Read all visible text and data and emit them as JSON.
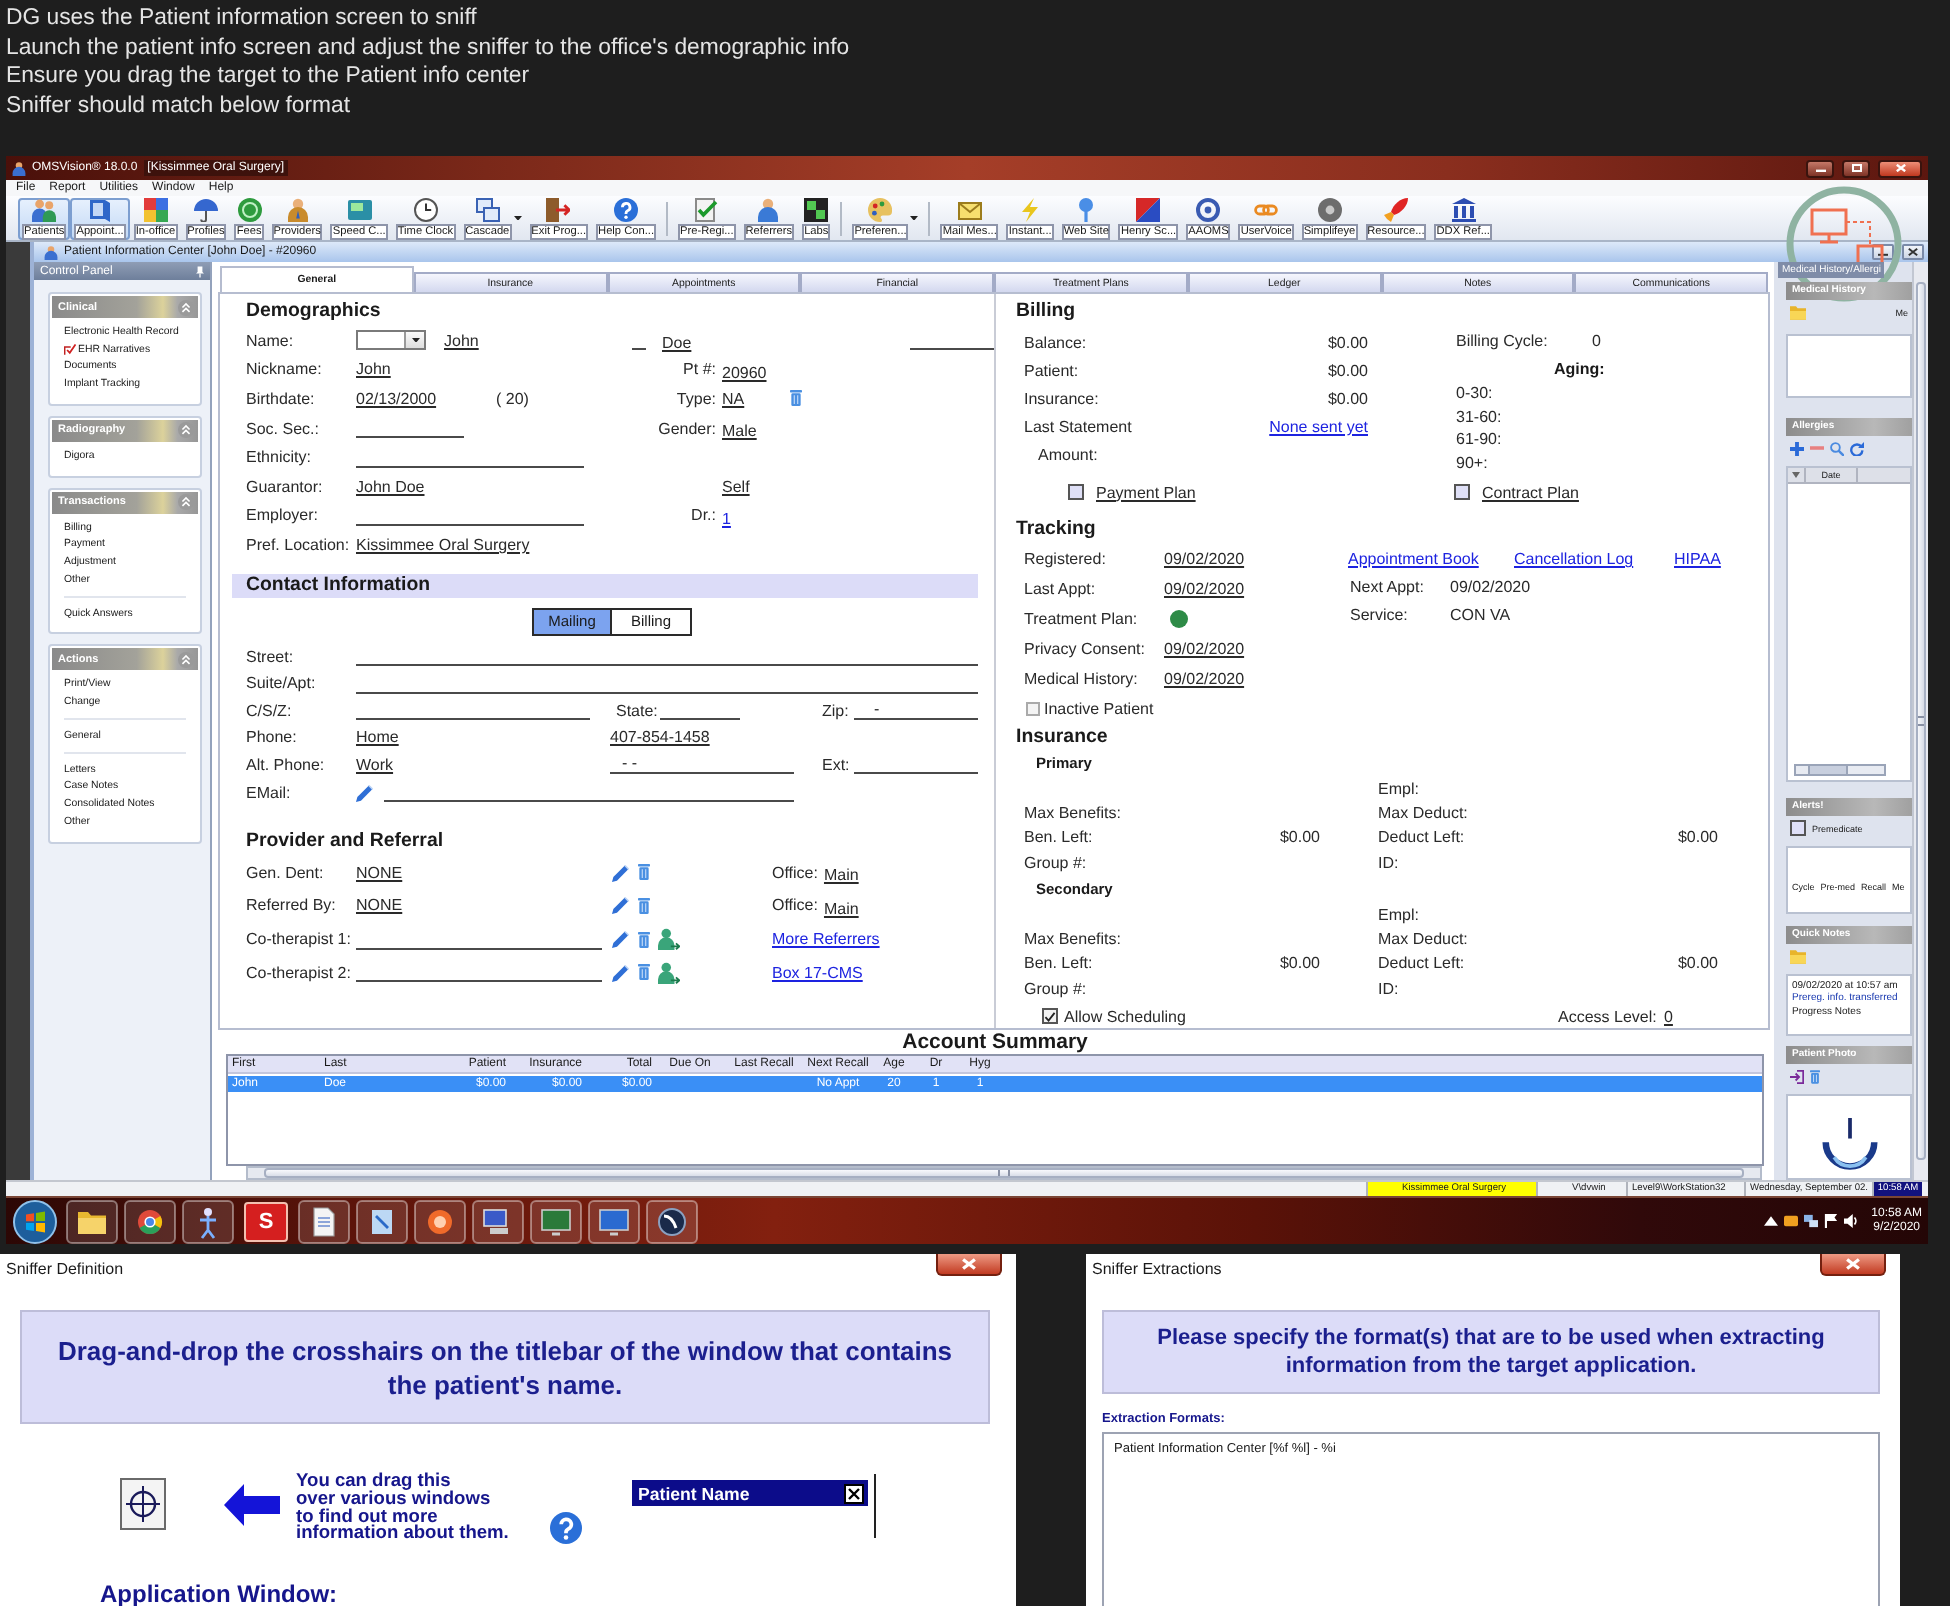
{
  "instructions": [
    "DG uses the Patient information screen to sniff",
    "Launch the patient info screen and adjust the sniffer to the office's demographic info",
    "Ensure you drag the target to the Patient info center",
    "Sniffer should match below format"
  ],
  "app_window": {
    "title": "OMSVision® 18.0.0",
    "title_context": "[Kissimmee Oral Surgery]"
  },
  "menu": [
    "File",
    "Report",
    "Utilities",
    "Window",
    "Help"
  ],
  "toolbar": [
    {
      "items": [
        {
          "label": "Patients",
          "selected": true,
          "dropdown": false
        },
        {
          "label": "Appoint...",
          "selected": true,
          "dropdown": false
        },
        {
          "label": "In-office",
          "selected": false,
          "dropdown": false
        },
        {
          "label": "Profiles",
          "selected": false,
          "dropdown": false
        },
        {
          "label": "Fees",
          "selected": false,
          "dropdown": false
        },
        {
          "label": "Providers",
          "selected": false,
          "dropdown": false
        },
        {
          "label": "Speed C...",
          "selected": false,
          "dropdown": false
        },
        {
          "label": "Time Clock",
          "selected": false,
          "dropdown": false
        },
        {
          "label": "Cascade",
          "selected": false,
          "dropdown": true
        },
        {
          "label": "Exit Prog...",
          "selected": false,
          "dropdown": false
        },
        {
          "label": "Help Con...",
          "selected": false,
          "dropdown": false
        }
      ]
    },
    {
      "items": [
        {
          "label": "Pre-Regi...",
          "selected": false,
          "dropdown": false
        },
        {
          "label": "Referrers",
          "selected": false,
          "dropdown": false
        },
        {
          "label": "Labs",
          "selected": false,
          "dropdown": false
        }
      ]
    },
    {
      "items": [
        {
          "label": "Preferen...",
          "selected": false,
          "dropdown": true
        }
      ]
    },
    {
      "items": [
        {
          "label": "Mail Mes...",
          "selected": false,
          "dropdown": false
        },
        {
          "label": "Instant...",
          "selected": false,
          "dropdown": false
        },
        {
          "label": "Web Site",
          "selected": false,
          "dropdown": false
        },
        {
          "label": "Henry Sc...",
          "selected": false,
          "dropdown": false
        },
        {
          "label": "AAOMS",
          "selected": false,
          "dropdown": false
        },
        {
          "label": "UserVoice",
          "selected": false,
          "dropdown": false
        },
        {
          "label": "Simplifeye",
          "selected": false,
          "dropdown": false
        },
        {
          "label": "Resource...",
          "selected": false,
          "dropdown": false
        },
        {
          "label": "DDX Ref...",
          "selected": false,
          "dropdown": false
        }
      ]
    }
  ],
  "patient_window": {
    "title": "Patient Information Center [John Doe] - #20960"
  },
  "control_panel": {
    "title": "Control Panel",
    "sections": [
      {
        "title": "Clinical",
        "groups": [
          [
            "Electronic Health Record",
            "EHR Narratives",
            "Documents",
            "Implant Tracking"
          ]
        ]
      },
      {
        "title": "Radiography",
        "groups": [
          [
            "Digora"
          ]
        ]
      },
      {
        "title": "Transactions",
        "groups": [
          [
            "Billing",
            "Payment",
            "Adjustment",
            "Other"
          ],
          [
            "Quick Answers"
          ]
        ]
      },
      {
        "title": "Actions",
        "groups": [
          [
            "Print/View",
            "Change"
          ],
          [
            "General"
          ],
          [
            "Letters",
            "Case Notes",
            "Consolidated Notes",
            "Other"
          ]
        ]
      }
    ]
  },
  "tabs": [
    {
      "label": "General",
      "selected": true
    },
    {
      "label": "Insurance",
      "selected": false
    },
    {
      "label": "Appointments",
      "selected": false
    },
    {
      "label": "Financial",
      "selected": false
    },
    {
      "label": "Treatment Plans",
      "selected": false
    },
    {
      "label": "Ledger",
      "selected": false
    },
    {
      "label": "Notes",
      "selected": false
    },
    {
      "label": "Communications",
      "selected": false
    }
  ],
  "demographics": {
    "title": "Demographics",
    "name": {
      "label": "Name:",
      "first": "John",
      "last": "Doe"
    },
    "nickname": {
      "label": "Nickname:",
      "value": "John"
    },
    "pt_number": {
      "label": "Pt #:",
      "value": "20960"
    },
    "birthdate": {
      "label": "Birthdate:",
      "value": "02/13/2000",
      "age": "( 20)"
    },
    "type": {
      "label": "Type:",
      "value": "NA"
    },
    "soc_sec": {
      "label": "Soc. Sec.:"
    },
    "gender": {
      "label": "Gender:",
      "value": "Male"
    },
    "ethnicity": {
      "label": "Ethnicity:"
    },
    "guarantor": {
      "label": "Guarantor:",
      "value": "John Doe",
      "relation": "Self"
    },
    "employer": {
      "label": "Employer:"
    },
    "dr": {
      "label": "Dr.:",
      "value": "1"
    },
    "pref_location": {
      "label": "Pref. Location:",
      "value": "Kissimmee Oral Surgery"
    }
  },
  "contact": {
    "title": "Contact Information",
    "address_tabs": [
      {
        "label": "Mailing",
        "selected": true
      },
      {
        "label": "Billing",
        "selected": false
      }
    ],
    "street": {
      "label": "Street:"
    },
    "suite": {
      "label": "Suite/Apt:"
    },
    "csz": {
      "label": "C/S/Z:",
      "state_label": "State:",
      "zip_label": "Zip:",
      "zip_value": "-"
    },
    "phone": {
      "label": "Phone:",
      "type": "Home",
      "value": "407-854-1458"
    },
    "alt_phone": {
      "label": "Alt. Phone:",
      "type": "Work",
      "value": "-  -",
      "ext_label": "Ext:"
    },
    "email": {
      "label": "EMail:"
    }
  },
  "provider_referral": {
    "title": "Provider and Referral",
    "rows": [
      {
        "kind": "provider",
        "label": "Gen. Dent:",
        "value": "NONE",
        "office_label": "Office:",
        "office": "Main"
      },
      {
        "kind": "provider",
        "label": "Referred By:",
        "value": "NONE",
        "office_label": "Office:",
        "office": "Main"
      },
      {
        "kind": "cotherapist",
        "label": "Co-therapist 1:",
        "link": "More Referrers"
      },
      {
        "kind": "cotherapist",
        "label": "Co-therapist 2:",
        "link": "Box 17-CMS"
      }
    ]
  },
  "billing": {
    "title": "Billing",
    "rows": [
      {
        "kind": "amount",
        "label": "Balance:",
        "value": "$0.00"
      },
      {
        "kind": "amount",
        "label": "Patient:",
        "value": "$0.00"
      },
      {
        "kind": "amount",
        "label": "Insurance:",
        "value": "$0.00"
      },
      {
        "kind": "link",
        "label": "Last Statement",
        "link": "None sent yet",
        "children": [
          {
            "label": "Amount:"
          }
        ]
      }
    ],
    "billing_cycle": {
      "label": "Billing Cycle:",
      "value": "0"
    },
    "aging": {
      "title": "Aging:",
      "buckets": [
        "0-30:",
        "31-60:",
        "61-90:",
        "90+:"
      ]
    },
    "plans": [
      {
        "label": "Payment Plan",
        "checked": false
      },
      {
        "label": "Contract Plan",
        "checked": false
      }
    ]
  },
  "tracking": {
    "title": "Tracking",
    "rows": [
      {
        "kind": "date",
        "label": "Registered:",
        "value": "09/02/2020"
      },
      {
        "kind": "date",
        "label": "Last Appt:",
        "value": "09/02/2020"
      },
      {
        "kind": "status",
        "label": "Treatment Plan:",
        "color": "#2e8b47"
      },
      {
        "kind": "date",
        "label": "Privacy Consent:",
        "value": "09/02/2020"
      },
      {
        "kind": "date",
        "label": "Medical History:",
        "value": "09/02/2020"
      }
    ],
    "inactive_patient": {
      "label": "Inactive Patient",
      "checked": false
    },
    "links": [
      "Appointment Book",
      "Cancellation Log",
      "HIPAA"
    ],
    "next_appt": {
      "label": "Next Appt:",
      "value": "09/02/2020"
    },
    "service": {
      "label": "Service:",
      "value": "CON VA"
    }
  },
  "insurance": {
    "title": "Insurance",
    "plans": [
      {
        "title": "Primary",
        "empl_label": "Empl:",
        "max_benefits_label": "Max Benefits:",
        "max_deduct_label": "Max Deduct:",
        "ben_left_label": "Ben. Left:",
        "ben_left": "$0.00",
        "deduct_left_label": "Deduct Left:",
        "deduct_left": "$0.00",
        "group_label": "Group #:",
        "id_label": "ID:"
      },
      {
        "title": "Secondary",
        "empl_label": "Empl:",
        "max_benefits_label": "Max Benefits:",
        "max_deduct_label": "Max Deduct:",
        "ben_left_label": "Ben. Left:",
        "ben_left": "$0.00",
        "deduct_left_label": "Deduct Left:",
        "deduct_left": "$0.00",
        "group_label": "Group #:",
        "id_label": "ID:"
      }
    ],
    "allow_scheduling": {
      "label": "Allow Scheduling",
      "checked": true
    },
    "access_level": {
      "label": "Access Level:",
      "value": "0"
    }
  },
  "account_summary": {
    "title": "Account Summary",
    "columns": [
      "First",
      "Last",
      "Patient",
      "Insurance",
      "Total",
      "Due On",
      "Last Recall",
      "Next Recall",
      "Age",
      "Dr",
      "Hyg"
    ],
    "rows": [
      {
        "selected": true,
        "cells": [
          "John",
          "Doe",
          "$0.00",
          "$0.00",
          "$0.00",
          null,
          null,
          "No Appt",
          "20",
          "1",
          "1"
        ]
      }
    ]
  },
  "sidebar": {
    "tab_label": "Medical History/Allergi",
    "medical_history": {
      "title": "Medical History",
      "cut_label": "Me"
    },
    "allergies": {
      "title": "Allergies",
      "columns": [
        "Date"
      ]
    },
    "alerts": {
      "title": "Alerts!",
      "premedicate": {
        "label": "Premedicate",
        "checked": false
      },
      "columns": [
        "Cycle",
        "Pre-med",
        "Recall",
        "Me"
      ]
    },
    "quick_notes": {
      "title": "Quick Notes",
      "lines": [
        "09/02/2020 at 10:57 am",
        "Prereg. info. transferred",
        "Progress Notes"
      ]
    },
    "patient_photo": {
      "title": "Patient Photo"
    }
  },
  "status_bar": {
    "office": "Kissimmee Oral Surgery",
    "path": "V\\dvwin",
    "workstation": "Level9\\WorkStation32",
    "date": "Wednesday, September 02.",
    "time": "10:58 AM"
  },
  "taskbar": {
    "letter_tile": "S",
    "time": "10:58 AM",
    "date": "9/2/2020"
  },
  "sniffer_definition": {
    "title": "Sniffer Definition",
    "instruction_lines": [
      "Drag-and-drop the crosshairs on the titlebar of the window that contains",
      "the patient's name."
    ],
    "hint_lines": [
      "You can drag this",
      "over various windows",
      "to find out more",
      "information about them."
    ],
    "target_title": "Patient Name",
    "section_label": "Application Window:"
  },
  "sniffer_extractions": {
    "title": "Sniffer Extractions",
    "instruction_lines": [
      "Please specify the format(s) that are to be used when extracting",
      "information from the target application."
    ],
    "formats_label": "Extraction Formats:",
    "formats_value": "Patient Information Center [%f %l] - %i"
  }
}
